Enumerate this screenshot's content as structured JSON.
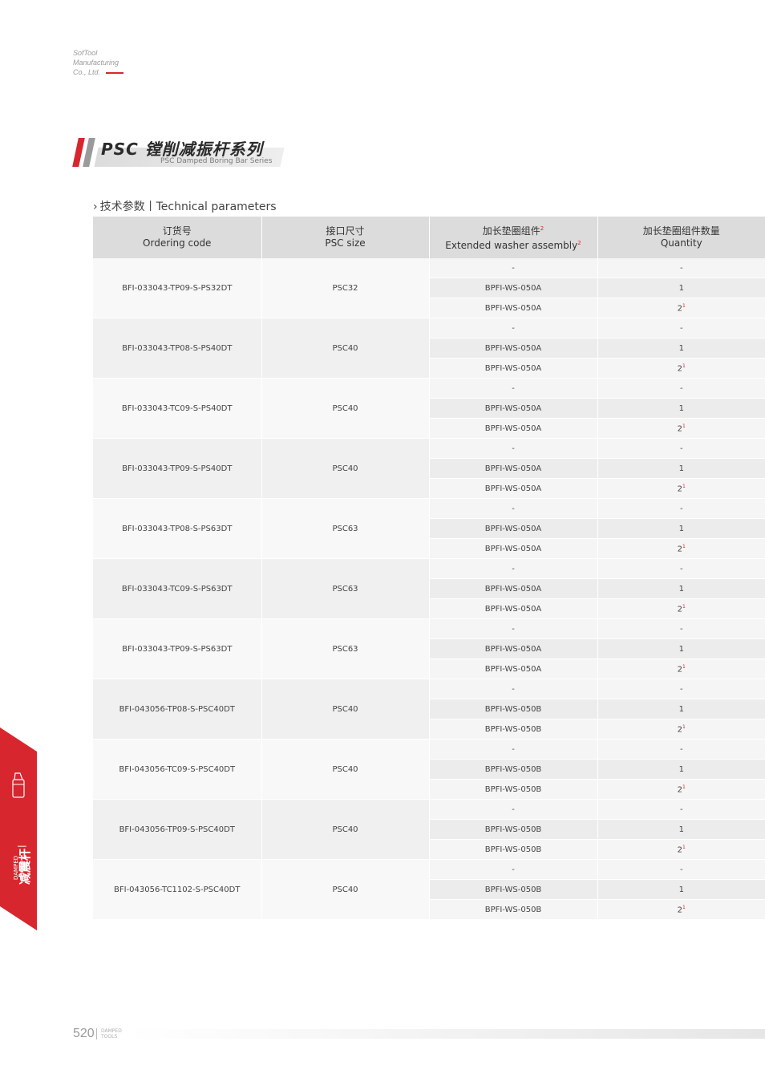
{
  "company": [
    "SofTool",
    "Manufacturing",
    "Co., Ltd."
  ],
  "title": {
    "main": "PSC 镗削减振杆系列",
    "sub": "PSC Damped Boring Bar Series"
  },
  "section": "技术参数丨Technical parameters",
  "headers": [
    {
      "cn": "订货号",
      "en": "Ordering code",
      "sup": ""
    },
    {
      "cn": "接口尺寸",
      "en": "PSC size",
      "sup": ""
    },
    {
      "cn": "加长垫圈组件",
      "en": "Extended washer assembly",
      "sup": "2"
    },
    {
      "cn": "加长垫圈组件数量",
      "en": "Quantity",
      "sup": ""
    }
  ],
  "rows": [
    {
      "code": "BFI-033043-TP09-S-PS32DT",
      "size": "PSC32",
      "assemblies": [
        "-",
        "BPFI-WS-050A",
        "BPFI-WS-050A"
      ],
      "quantities": [
        "-",
        "1",
        "2"
      ]
    },
    {
      "code": "BFI-033043-TP08-S-PS40DT",
      "size": "PSC40",
      "assemblies": [
        "-",
        "BPFI-WS-050A",
        "BPFI-WS-050A"
      ],
      "quantities": [
        "-",
        "1",
        "2"
      ]
    },
    {
      "code": "BFI-033043-TC09-S-PS40DT",
      "size": "PSC40",
      "assemblies": [
        "-",
        "BPFI-WS-050A",
        "BPFI-WS-050A"
      ],
      "quantities": [
        "-",
        "1",
        "2"
      ]
    },
    {
      "code": "BFI-033043-TP09-S-PS40DT",
      "size": "PSC40",
      "assemblies": [
        "-",
        "BPFI-WS-050A",
        "BPFI-WS-050A"
      ],
      "quantities": [
        "-",
        "1",
        "2"
      ]
    },
    {
      "code": "BFI-033043-TP08-S-PS63DT",
      "size": "PSC63",
      "assemblies": [
        "-",
        "BPFI-WS-050A",
        "BPFI-WS-050A"
      ],
      "quantities": [
        "-",
        "1",
        "2"
      ]
    },
    {
      "code": "BFI-033043-TC09-S-PS63DT",
      "size": "PSC63",
      "assemblies": [
        "-",
        "BPFI-WS-050A",
        "BPFI-WS-050A"
      ],
      "quantities": [
        "-",
        "1",
        "2"
      ]
    },
    {
      "code": "BFI-033043-TP09-S-PS63DT",
      "size": "PSC63",
      "assemblies": [
        "-",
        "BPFI-WS-050A",
        "BPFI-WS-050A"
      ],
      "quantities": [
        "-",
        "1",
        "2"
      ]
    },
    {
      "code": "BFI-043056-TP08-S-PSC40DT",
      "size": "PSC40",
      "assemblies": [
        "-",
        "BPFI-WS-050B",
        "BPFI-WS-050B"
      ],
      "quantities": [
        "-",
        "1",
        "2"
      ]
    },
    {
      "code": "BFI-043056-TC09-S-PSC40DT",
      "size": "PSC40",
      "assemblies": [
        "-",
        "BPFI-WS-050B",
        "BPFI-WS-050B"
      ],
      "quantities": [
        "-",
        "1",
        "2"
      ]
    },
    {
      "code": "BFI-043056-TP09-S-PSC40DT",
      "size": "PSC40",
      "assemblies": [
        "-",
        "BPFI-WS-050B",
        "BPFI-WS-050B"
      ],
      "quantities": [
        "-",
        "1",
        "2"
      ]
    },
    {
      "code": "BFI-043056-TC1102-S-PSC40DT",
      "size": "PSC40",
      "assemblies": [
        "-",
        "BPFI-WS-050B",
        "BPFI-WS-050B"
      ],
      "quantities": [
        "-",
        "1",
        "2"
      ]
    }
  ],
  "qty_footnote": "1",
  "side_tab": {
    "cn": "减震杆",
    "sep": "|",
    "en_line1": "DAMPED",
    "en_line2": "TOOLS"
  },
  "footer": {
    "page": "520",
    "label_line1": "DAMPED",
    "label_line2": "TOOLS"
  },
  "colors": {
    "accent": "#d8262e",
    "header_bg": "#dcdcdc"
  }
}
